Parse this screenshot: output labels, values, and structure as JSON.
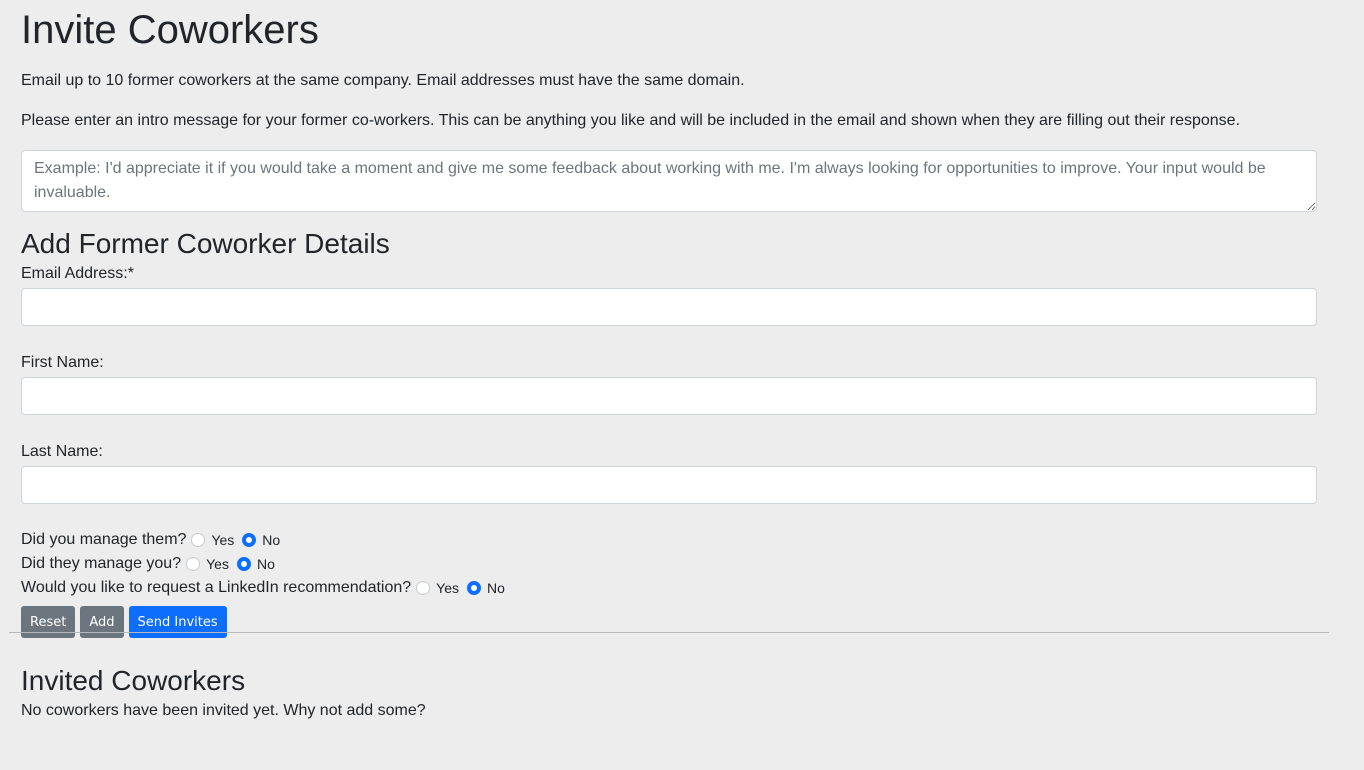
{
  "header": {
    "title": "Invite Coworkers",
    "description": "Email up to 10 former coworkers at the same company. Email addresses must have the same domain.",
    "intro_prompt": "Please enter an intro message for your former co-workers. This can be anything you like and will be included in the email and shown when they are filling out their response."
  },
  "intro_message": {
    "value": "",
    "placeholder": "Example: I'd appreciate it if you would take a moment and give me some feedback about working with me. I'm always looking for opportunities to improve. Your input would be invaluable."
  },
  "details": {
    "heading": "Add Former Coworker Details",
    "email_label": "Email Address:*",
    "email_value": "",
    "first_name_label": "First Name:",
    "first_name_value": "",
    "last_name_label": "Last Name:",
    "last_name_value": ""
  },
  "questions": [
    {
      "label": "Did you manage them?",
      "yes": "Yes",
      "no": "No",
      "selected": "No"
    },
    {
      "label": "Did they manage you?",
      "yes": "Yes",
      "no": "No",
      "selected": "No"
    },
    {
      "label": "Would you like to request a LinkedIn recommendation?",
      "yes": "Yes",
      "no": "No",
      "selected": "No"
    }
  ],
  "buttons": {
    "reset": "Reset",
    "add": "Add",
    "send": "Send Invites"
  },
  "invited": {
    "heading": "Invited Coworkers",
    "empty_message": "No coworkers have been invited yet. Why not add some?"
  },
  "colors": {
    "background": "#ededed",
    "primary": "#0d6efd",
    "secondary": "#6c757d"
  }
}
